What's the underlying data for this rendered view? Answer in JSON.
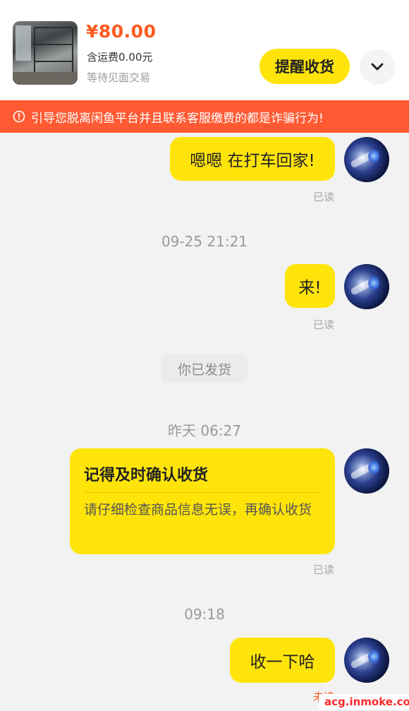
{
  "header": {
    "price": "¥80.00",
    "shipping": "含运费0.00元",
    "status": "等待见面交易",
    "remind_label": "提醒收货",
    "expand_icon": "chevron-down-icon"
  },
  "warning": {
    "text": "引导您脱离闲鱼平台并且联系客服缴费的都是诈骗行为!",
    "icon": "alert-circle-icon"
  },
  "messages": [
    {
      "text": "嗯嗯 在打车回家!",
      "read": "已读"
    },
    {
      "text": "来!",
      "read": "已读"
    },
    {
      "text": "收一下哈",
      "read": "未读"
    }
  ],
  "timestamps": [
    "09-25 21:21",
    "昨天 06:27",
    "09:18"
  ],
  "system": {
    "shipped": "你已发货"
  },
  "card": {
    "title": "记得及时确认收货",
    "body": "请仔细检查商品信息无误，再确认收货",
    "read": "已读"
  },
  "watermark": "acg.inmoke.com",
  "colors": {
    "accent_yellow": "#ffe40a",
    "price_orange": "#ff5a1f",
    "warning_bg": "#ff5a32"
  }
}
